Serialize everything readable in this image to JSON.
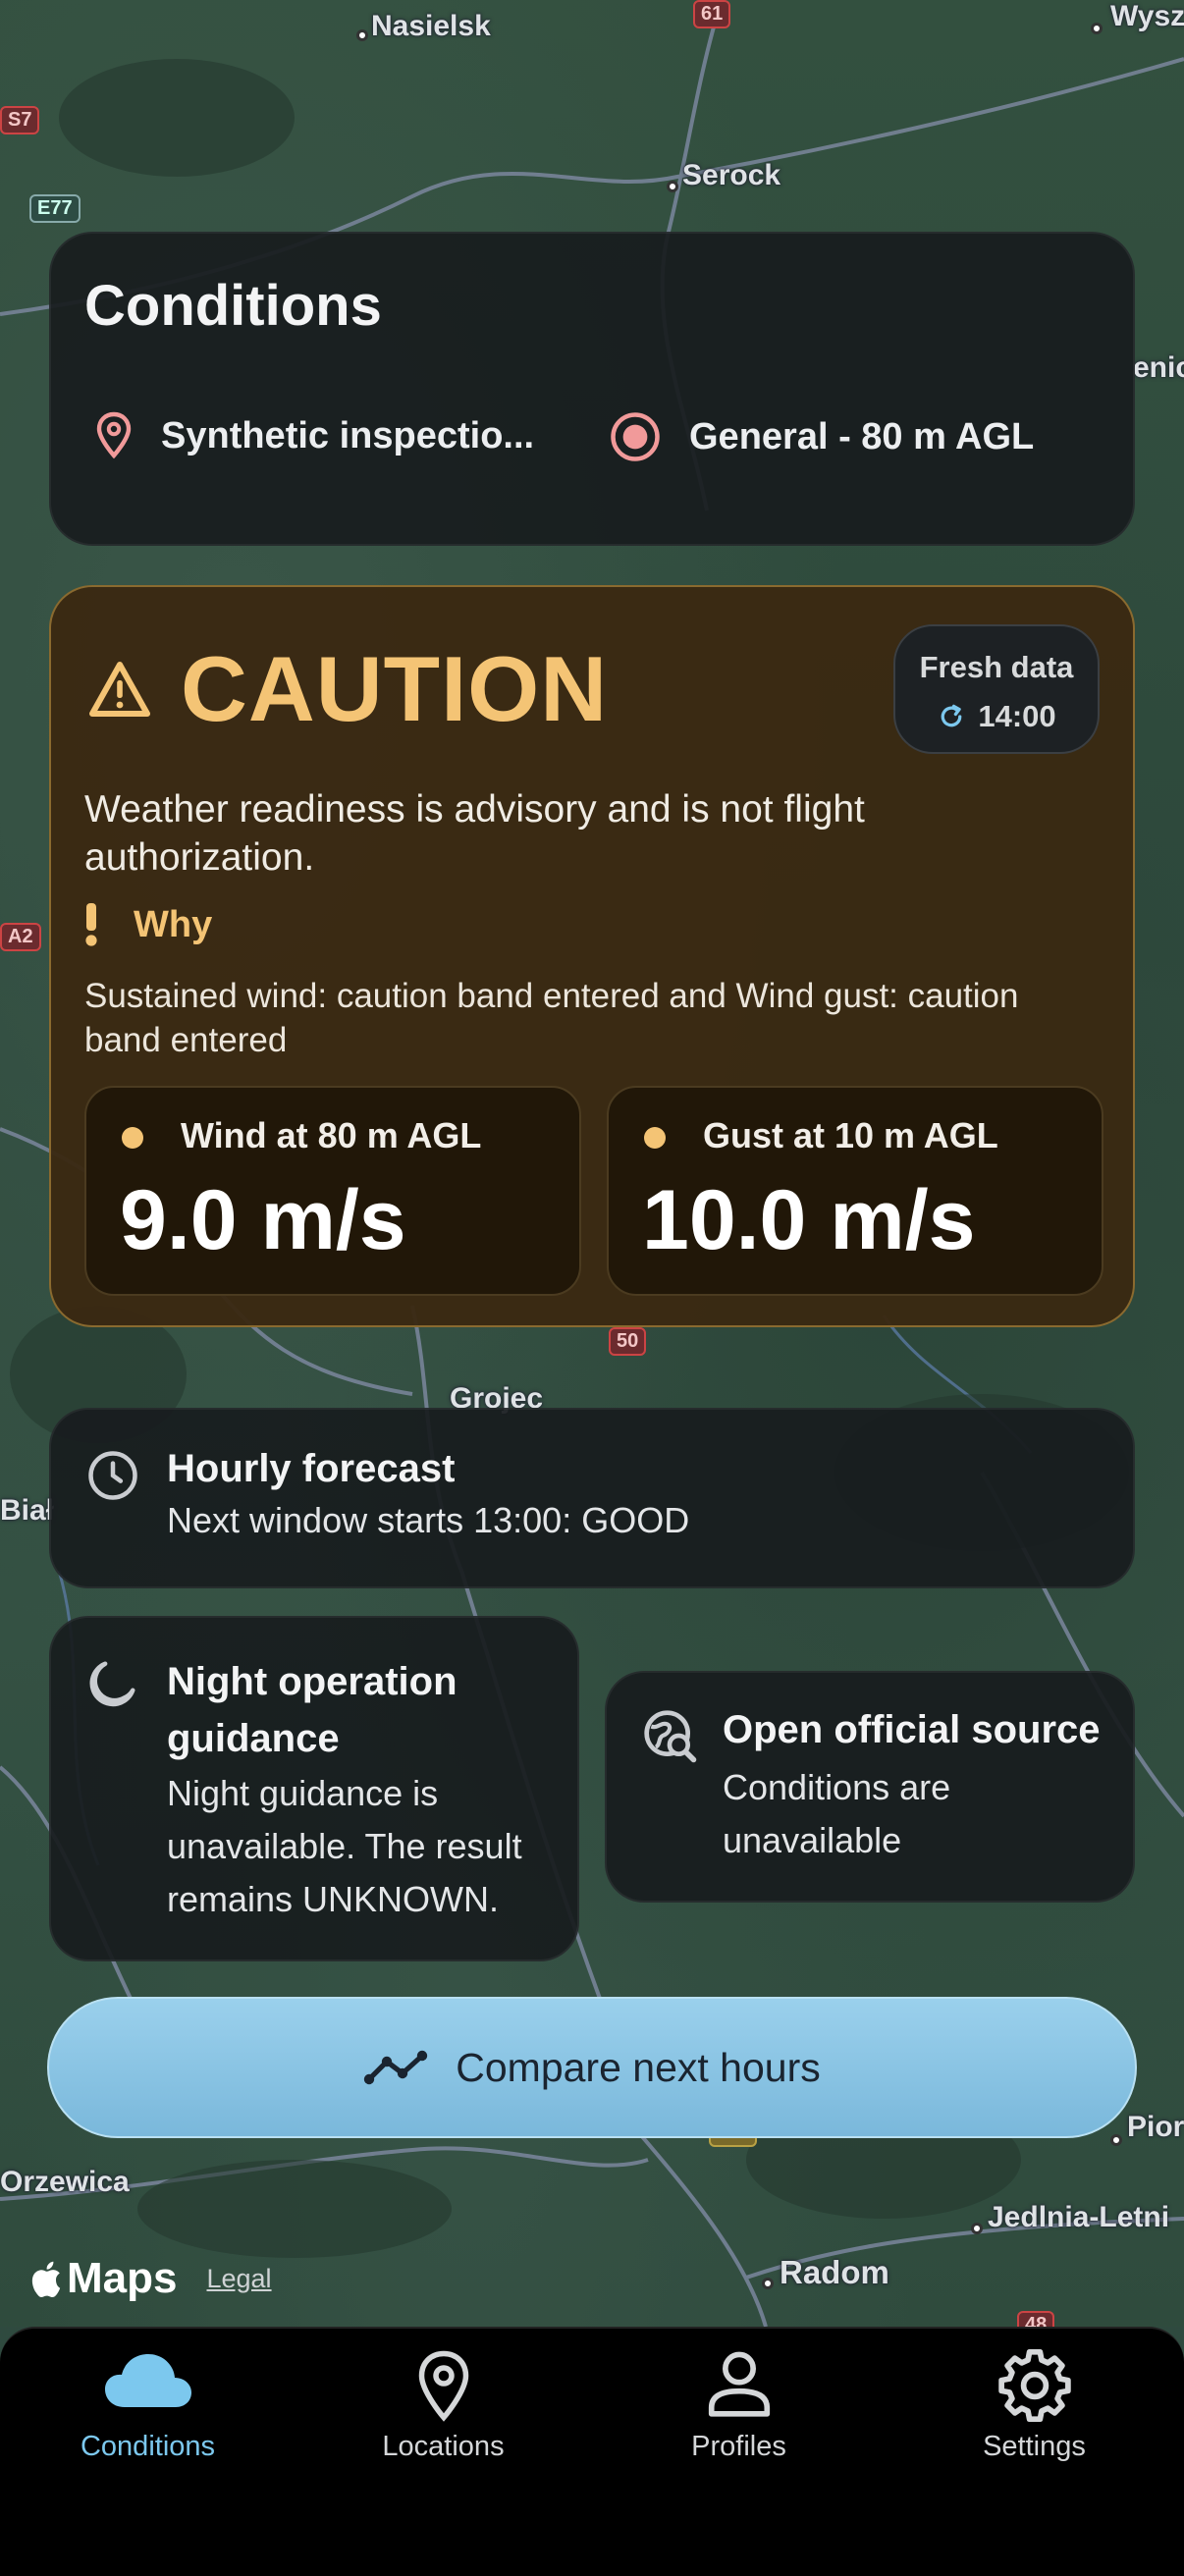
{
  "map": {
    "places": [
      "Nasielsk",
      "Serock",
      "Wysz",
      "Jedlnia-Letni",
      "Radom",
      "Grojec",
      "Orzewica",
      "Pior",
      "Biał",
      "enic"
    ],
    "road_shields": [
      "S7",
      "E77",
      "61",
      "A2",
      "50",
      "735",
      "48"
    ]
  },
  "conditions": {
    "title": "Conditions",
    "location": "Synthetic inspectio...",
    "profile": "General - 80 m AGL"
  },
  "caution": {
    "status": "CAUTION",
    "fresh_label": "Fresh data",
    "fresh_time": "14:00",
    "advisory": "Weather readiness is advisory and is not flight authorization.",
    "why_label": "Why",
    "why_text": "Sustained wind: caution band entered and Wind gust: caution band entered",
    "metrics": [
      {
        "label": "Wind at 80 m AGL",
        "value": "9.0 m/s"
      },
      {
        "label": "Gust at 10 m AGL",
        "value": "10.0 m/s"
      }
    ],
    "accent_color": "#f4c475"
  },
  "hourly": {
    "title": "Hourly forecast",
    "subtitle": "Next window starts 13:00: GOOD"
  },
  "night": {
    "title": "Night operation guidance",
    "subtitle": "Night guidance is unavailable. The result remains UNKNOWN."
  },
  "source": {
    "title": "Open official source",
    "subtitle": "Conditions are unavailable"
  },
  "compare": {
    "label": "Compare next hours"
  },
  "attribution": {
    "brand": "Maps",
    "legal": "Legal"
  },
  "tabs": [
    {
      "label": "Conditions",
      "icon": "cloud-icon",
      "active": true
    },
    {
      "label": "Locations",
      "icon": "location-pin-icon",
      "active": false
    },
    {
      "label": "Profiles",
      "icon": "person-icon",
      "active": false
    },
    {
      "label": "Settings",
      "icon": "gear-icon",
      "active": false
    }
  ]
}
